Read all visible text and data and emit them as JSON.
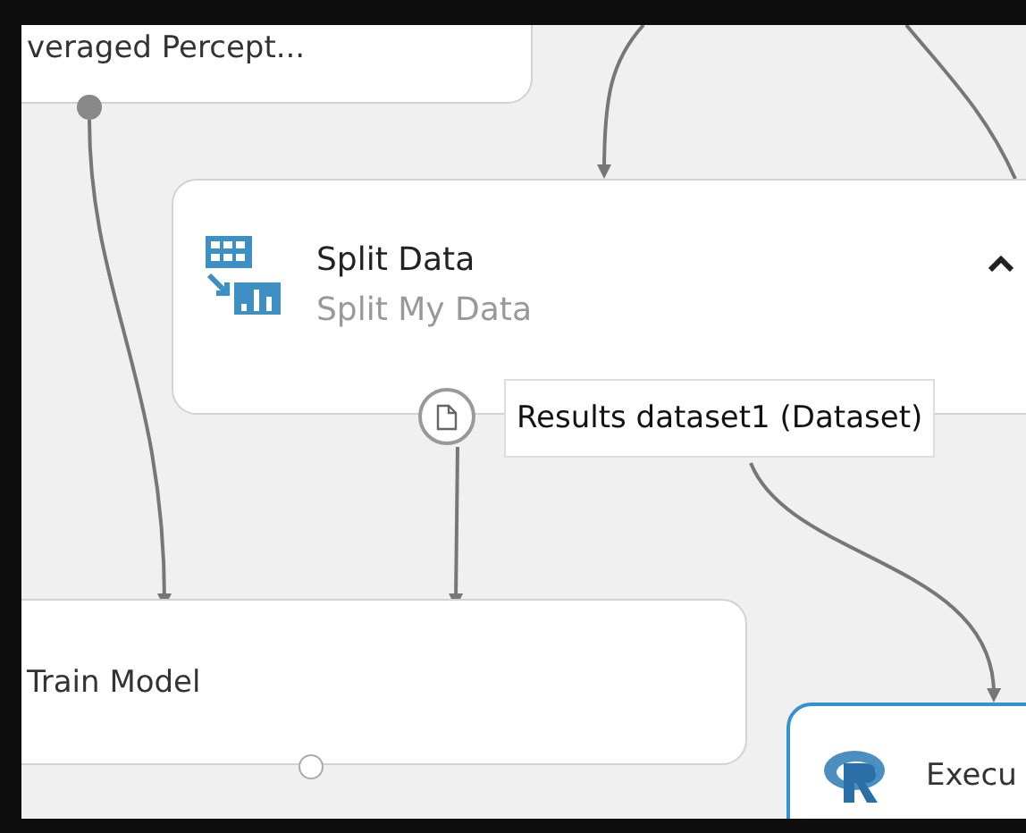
{
  "canvas": {
    "nodes": [
      {
        "title": "veraged Percept...",
        "selected": false
      },
      {
        "title": "Split Data",
        "subtitle": "Split My Data",
        "selected": false,
        "expanded": true
      },
      {
        "title": "Train Model",
        "selected": false
      },
      {
        "title": "Execu",
        "selected": true
      }
    ],
    "tooltip": {
      "text": "Results dataset1 (Dataset)"
    }
  }
}
